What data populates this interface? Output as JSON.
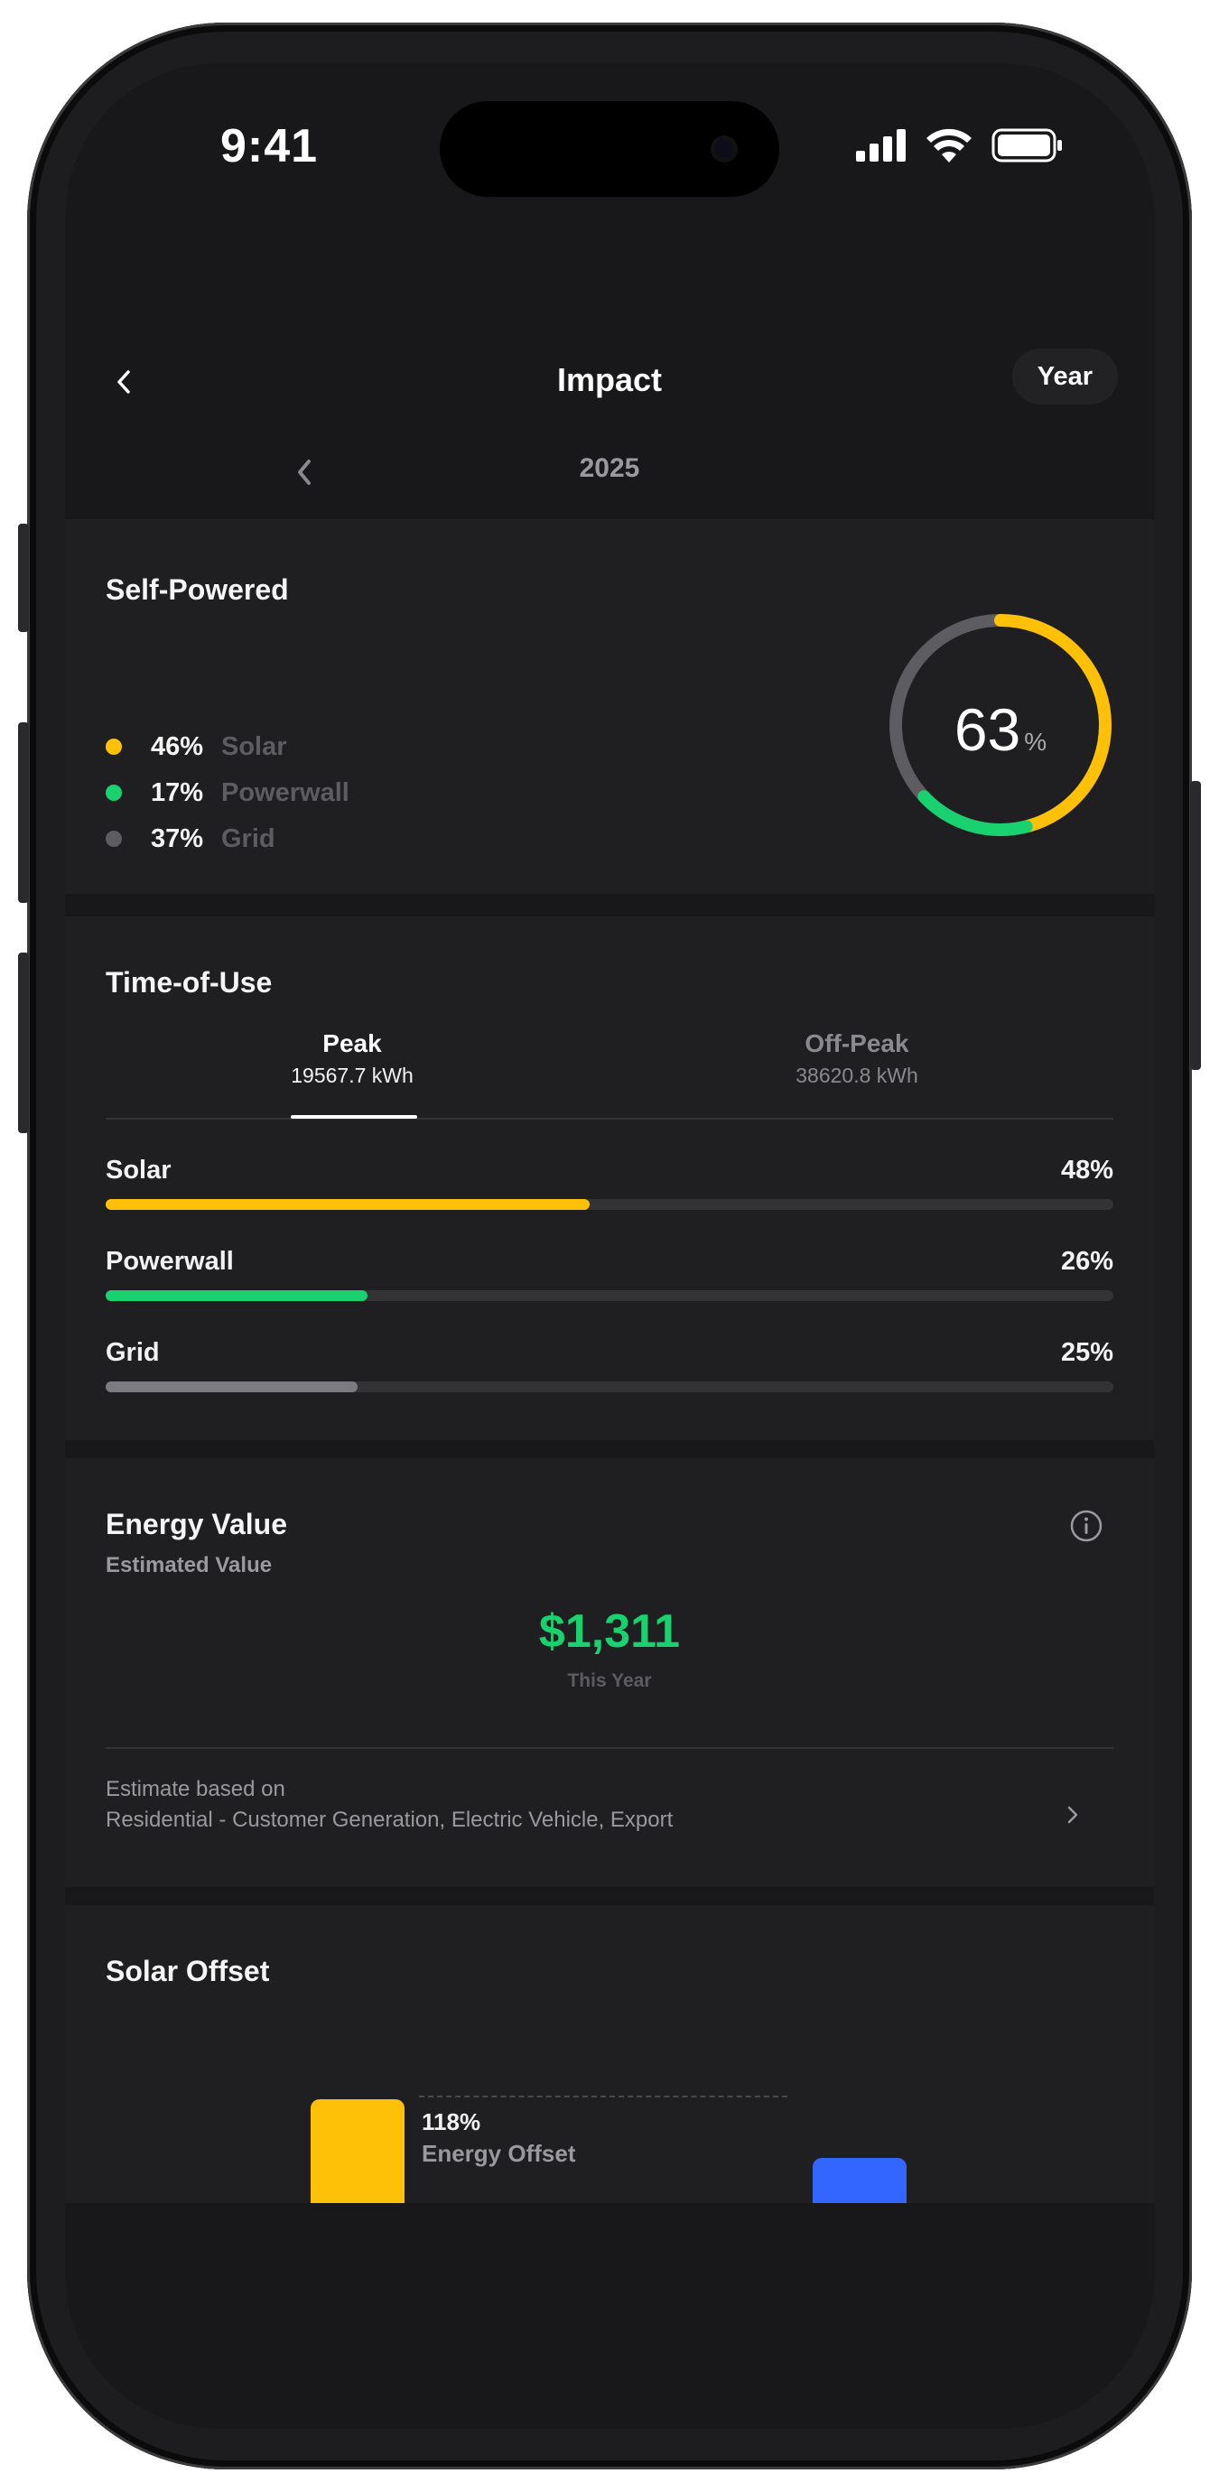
{
  "status_bar": {
    "time": "9:41"
  },
  "header": {
    "title": "Impact",
    "range": "Year"
  },
  "period": {
    "label": "2025"
  },
  "self_powered": {
    "title": "Self-Powered",
    "total": "63",
    "unit": "%",
    "items": [
      {
        "pct": "46%",
        "name": "Solar",
        "color": "#ffc107"
      },
      {
        "pct": "17%",
        "name": "Powerwall",
        "color": "#19d16f"
      },
      {
        "pct": "37%",
        "name": "Grid",
        "color": "#5d5d61"
      }
    ]
  },
  "time_of_use": {
    "title": "Time-of-Use",
    "tabs": [
      {
        "label": "Peak",
        "value": "19567.7 kWh",
        "selected": true
      },
      {
        "label": "Off-Peak",
        "value": "38620.8 kWh",
        "selected": false
      }
    ],
    "bars": [
      {
        "name": "Solar",
        "pct": "48%",
        "fraction": 0.48,
        "color": "#ffc107"
      },
      {
        "name": "Powerwall",
        "pct": "26%",
        "fraction": 0.26,
        "color": "#19d16f"
      },
      {
        "name": "Grid",
        "pct": "25%",
        "fraction": 0.25,
        "color": "#7c7c80"
      }
    ]
  },
  "energy_value": {
    "title": "Energy Value",
    "subtitle": "Estimated Value",
    "amount": "$1,311",
    "period": "This Year",
    "estimate_line1": "Estimate based on",
    "estimate_line2": "Residential - Customer Generation, Electric Vehicle, Export"
  },
  "solar_offset": {
    "title": "Solar Offset",
    "pct": "118%",
    "label": "Energy Offset",
    "colors": {
      "solar": "#ffc107",
      "usage": "#3366ff"
    }
  }
}
